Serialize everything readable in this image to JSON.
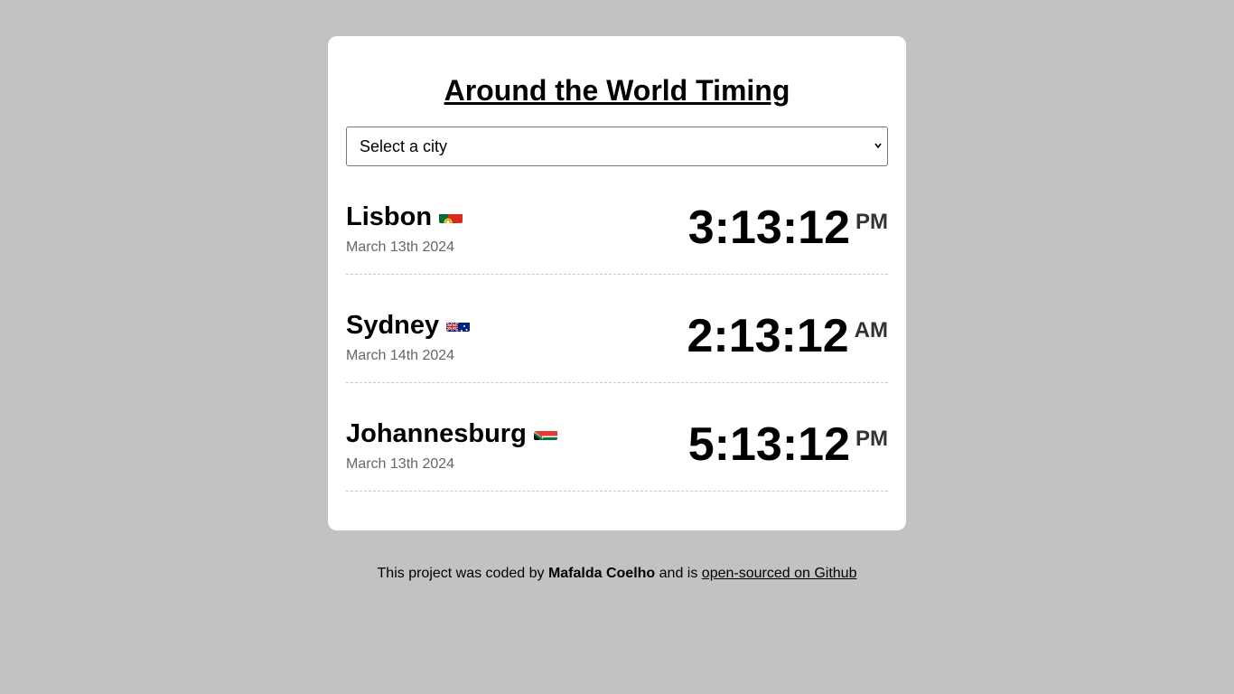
{
  "header": {
    "title": "Around the World Timing"
  },
  "city_select": {
    "value": "Select a city"
  },
  "cities": [
    {
      "name": "Lisbon",
      "flag": "portugal-flag-icon",
      "date": "March 13th 2024",
      "time": "3:13:12",
      "ampm": "PM"
    },
    {
      "name": "Sydney",
      "flag": "australia-flag-icon",
      "date": "March 14th 2024",
      "time": "2:13:12",
      "ampm": "AM"
    },
    {
      "name": "Johannesburg",
      "flag": "south-africa-flag-icon",
      "date": "March 13th 2024",
      "time": "5:13:12",
      "ampm": "PM"
    }
  ],
  "footer": {
    "prefix": "This project was coded by",
    "author": "Mafalda Coelho",
    "middle": "and is",
    "link": "open-sourced on Github"
  },
  "colors": {
    "background": "#c2c2c2",
    "card": "#ffffff",
    "muted": "#666666"
  }
}
